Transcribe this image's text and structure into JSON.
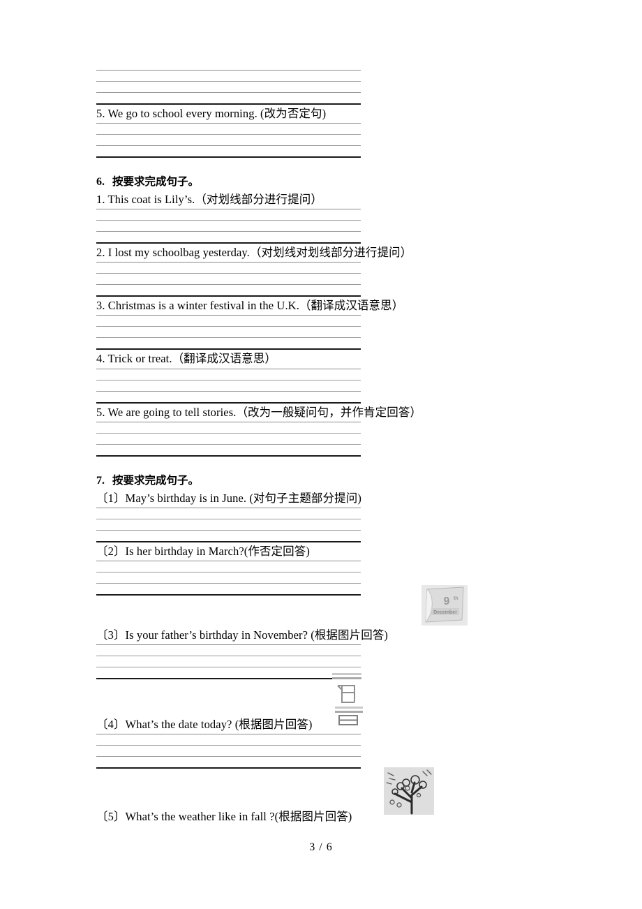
{
  "document": {
    "page_footer": "3 / 6",
    "background_color": "#ffffff",
    "rule_color": "#8a8a8a",
    "rule_bold_color": "#1a1a1a"
  },
  "top_answer_lines": {
    "count": 4
  },
  "carryover_question": {
    "text": "5. We go to school every morning. (改为否定句)"
  },
  "sections": [
    {
      "number": "6.",
      "title_cn": "按要求完成句子。",
      "items": [
        {
          "label": "1.",
          "text": "1. This coat is Lily’s.（对划线部分进行提问）"
        },
        {
          "label": "2.",
          "text": "2. I lost my schoolbag yesterday.（对划线对划线部分进行提问）"
        },
        {
          "label": "3.",
          "text": "3. Christmas is a winter festival in the U.K.（翻译成汉语意思）"
        },
        {
          "label": "4.",
          "text": "4. Trick or treat.（翻译成汉语意思）"
        },
        {
          "label": "5.",
          "text": "5. We are going to tell stories.（改为一般疑问句，并作肯定回答）"
        }
      ]
    },
    {
      "number": "7.",
      "title_cn": "按要求完成句子。",
      "items": [
        {
          "label": "〔1〕",
          "text": "〔1〕May’s birthday is in June. (对句子主题部分提问)"
        },
        {
          "label": "〔2〕",
          "text": "〔2〕Is her birthday in March?(作否定回答)"
        },
        {
          "label": "〔3〕",
          "text": "〔3〕Is your father’s birthday in November? (根据图片回答)"
        },
        {
          "label": "〔4〕",
          "text": "〔4〕What’s the date today? (根据图片回答)"
        },
        {
          "label": "〔5〕",
          "text": "〔5〕What’s the weather like in fall ?(根据图片回答)"
        }
      ]
    }
  ],
  "images": {
    "calendar_december": {
      "name": "calendar-december-image",
      "day_number": "9",
      "day_suffix": "th",
      "month_label": "December"
    },
    "date_watermark": {
      "name": "chinese-date-watermark-image",
      "description": "月 日"
    },
    "fall_tree": {
      "name": "fall-tree-weather-image",
      "description": "bare tree with falling leaves"
    }
  }
}
